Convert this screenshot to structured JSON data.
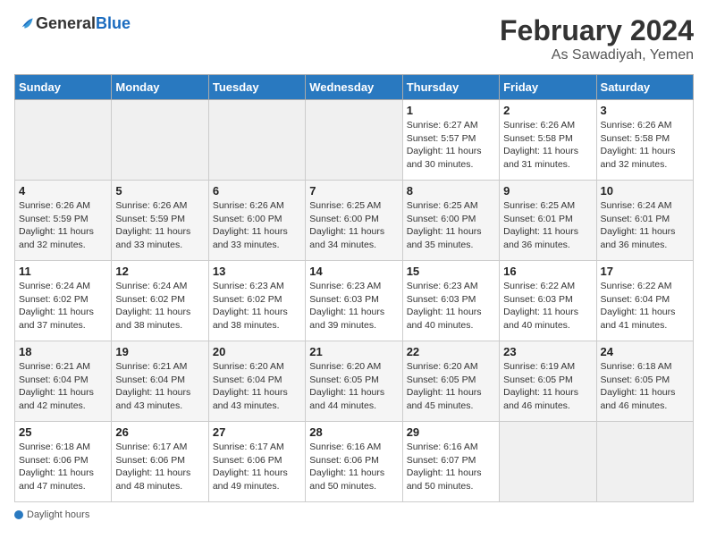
{
  "header": {
    "logo_general": "General",
    "logo_blue": "Blue",
    "month_year": "February 2024",
    "location": "As Sawadiyah, Yemen"
  },
  "days_of_week": [
    "Sunday",
    "Monday",
    "Tuesday",
    "Wednesday",
    "Thursday",
    "Friday",
    "Saturday"
  ],
  "weeks": [
    [
      {
        "day": "",
        "sunrise": "",
        "sunset": "",
        "daylight": "",
        "empty": true
      },
      {
        "day": "",
        "sunrise": "",
        "sunset": "",
        "daylight": "",
        "empty": true
      },
      {
        "day": "",
        "sunrise": "",
        "sunset": "",
        "daylight": "",
        "empty": true
      },
      {
        "day": "",
        "sunrise": "",
        "sunset": "",
        "daylight": "",
        "empty": true
      },
      {
        "day": "1",
        "sunrise": "Sunrise: 6:27 AM",
        "sunset": "Sunset: 5:57 PM",
        "daylight": "Daylight: 11 hours and 30 minutes.",
        "empty": false
      },
      {
        "day": "2",
        "sunrise": "Sunrise: 6:26 AM",
        "sunset": "Sunset: 5:58 PM",
        "daylight": "Daylight: 11 hours and 31 minutes.",
        "empty": false
      },
      {
        "day": "3",
        "sunrise": "Sunrise: 6:26 AM",
        "sunset": "Sunset: 5:58 PM",
        "daylight": "Daylight: 11 hours and 32 minutes.",
        "empty": false
      }
    ],
    [
      {
        "day": "4",
        "sunrise": "Sunrise: 6:26 AM",
        "sunset": "Sunset: 5:59 PM",
        "daylight": "Daylight: 11 hours and 32 minutes.",
        "empty": false
      },
      {
        "day": "5",
        "sunrise": "Sunrise: 6:26 AM",
        "sunset": "Sunset: 5:59 PM",
        "daylight": "Daylight: 11 hours and 33 minutes.",
        "empty": false
      },
      {
        "day": "6",
        "sunrise": "Sunrise: 6:26 AM",
        "sunset": "Sunset: 6:00 PM",
        "daylight": "Daylight: 11 hours and 33 minutes.",
        "empty": false
      },
      {
        "day": "7",
        "sunrise": "Sunrise: 6:25 AM",
        "sunset": "Sunset: 6:00 PM",
        "daylight": "Daylight: 11 hours and 34 minutes.",
        "empty": false
      },
      {
        "day": "8",
        "sunrise": "Sunrise: 6:25 AM",
        "sunset": "Sunset: 6:00 PM",
        "daylight": "Daylight: 11 hours and 35 minutes.",
        "empty": false
      },
      {
        "day": "9",
        "sunrise": "Sunrise: 6:25 AM",
        "sunset": "Sunset: 6:01 PM",
        "daylight": "Daylight: 11 hours and 36 minutes.",
        "empty": false
      },
      {
        "day": "10",
        "sunrise": "Sunrise: 6:24 AM",
        "sunset": "Sunset: 6:01 PM",
        "daylight": "Daylight: 11 hours and 36 minutes.",
        "empty": false
      }
    ],
    [
      {
        "day": "11",
        "sunrise": "Sunrise: 6:24 AM",
        "sunset": "Sunset: 6:02 PM",
        "daylight": "Daylight: 11 hours and 37 minutes.",
        "empty": false
      },
      {
        "day": "12",
        "sunrise": "Sunrise: 6:24 AM",
        "sunset": "Sunset: 6:02 PM",
        "daylight": "Daylight: 11 hours and 38 minutes.",
        "empty": false
      },
      {
        "day": "13",
        "sunrise": "Sunrise: 6:23 AM",
        "sunset": "Sunset: 6:02 PM",
        "daylight": "Daylight: 11 hours and 38 minutes.",
        "empty": false
      },
      {
        "day": "14",
        "sunrise": "Sunrise: 6:23 AM",
        "sunset": "Sunset: 6:03 PM",
        "daylight": "Daylight: 11 hours and 39 minutes.",
        "empty": false
      },
      {
        "day": "15",
        "sunrise": "Sunrise: 6:23 AM",
        "sunset": "Sunset: 6:03 PM",
        "daylight": "Daylight: 11 hours and 40 minutes.",
        "empty": false
      },
      {
        "day": "16",
        "sunrise": "Sunrise: 6:22 AM",
        "sunset": "Sunset: 6:03 PM",
        "daylight": "Daylight: 11 hours and 40 minutes.",
        "empty": false
      },
      {
        "day": "17",
        "sunrise": "Sunrise: 6:22 AM",
        "sunset": "Sunset: 6:04 PM",
        "daylight": "Daylight: 11 hours and 41 minutes.",
        "empty": false
      }
    ],
    [
      {
        "day": "18",
        "sunrise": "Sunrise: 6:21 AM",
        "sunset": "Sunset: 6:04 PM",
        "daylight": "Daylight: 11 hours and 42 minutes.",
        "empty": false
      },
      {
        "day": "19",
        "sunrise": "Sunrise: 6:21 AM",
        "sunset": "Sunset: 6:04 PM",
        "daylight": "Daylight: 11 hours and 43 minutes.",
        "empty": false
      },
      {
        "day": "20",
        "sunrise": "Sunrise: 6:20 AM",
        "sunset": "Sunset: 6:04 PM",
        "daylight": "Daylight: 11 hours and 43 minutes.",
        "empty": false
      },
      {
        "day": "21",
        "sunrise": "Sunrise: 6:20 AM",
        "sunset": "Sunset: 6:05 PM",
        "daylight": "Daylight: 11 hours and 44 minutes.",
        "empty": false
      },
      {
        "day": "22",
        "sunrise": "Sunrise: 6:20 AM",
        "sunset": "Sunset: 6:05 PM",
        "daylight": "Daylight: 11 hours and 45 minutes.",
        "empty": false
      },
      {
        "day": "23",
        "sunrise": "Sunrise: 6:19 AM",
        "sunset": "Sunset: 6:05 PM",
        "daylight": "Daylight: 11 hours and 46 minutes.",
        "empty": false
      },
      {
        "day": "24",
        "sunrise": "Sunrise: 6:18 AM",
        "sunset": "Sunset: 6:05 PM",
        "daylight": "Daylight: 11 hours and 46 minutes.",
        "empty": false
      }
    ],
    [
      {
        "day": "25",
        "sunrise": "Sunrise: 6:18 AM",
        "sunset": "Sunset: 6:06 PM",
        "daylight": "Daylight: 11 hours and 47 minutes.",
        "empty": false
      },
      {
        "day": "26",
        "sunrise": "Sunrise: 6:17 AM",
        "sunset": "Sunset: 6:06 PM",
        "daylight": "Daylight: 11 hours and 48 minutes.",
        "empty": false
      },
      {
        "day": "27",
        "sunrise": "Sunrise: 6:17 AM",
        "sunset": "Sunset: 6:06 PM",
        "daylight": "Daylight: 11 hours and 49 minutes.",
        "empty": false
      },
      {
        "day": "28",
        "sunrise": "Sunrise: 6:16 AM",
        "sunset": "Sunset: 6:06 PM",
        "daylight": "Daylight: 11 hours and 50 minutes.",
        "empty": false
      },
      {
        "day": "29",
        "sunrise": "Sunrise: 6:16 AM",
        "sunset": "Sunset: 6:07 PM",
        "daylight": "Daylight: 11 hours and 50 minutes.",
        "empty": false
      },
      {
        "day": "",
        "sunrise": "",
        "sunset": "",
        "daylight": "",
        "empty": true
      },
      {
        "day": "",
        "sunrise": "",
        "sunset": "",
        "daylight": "",
        "empty": true
      }
    ]
  ],
  "footer": {
    "daylight_label": "Daylight hours"
  }
}
